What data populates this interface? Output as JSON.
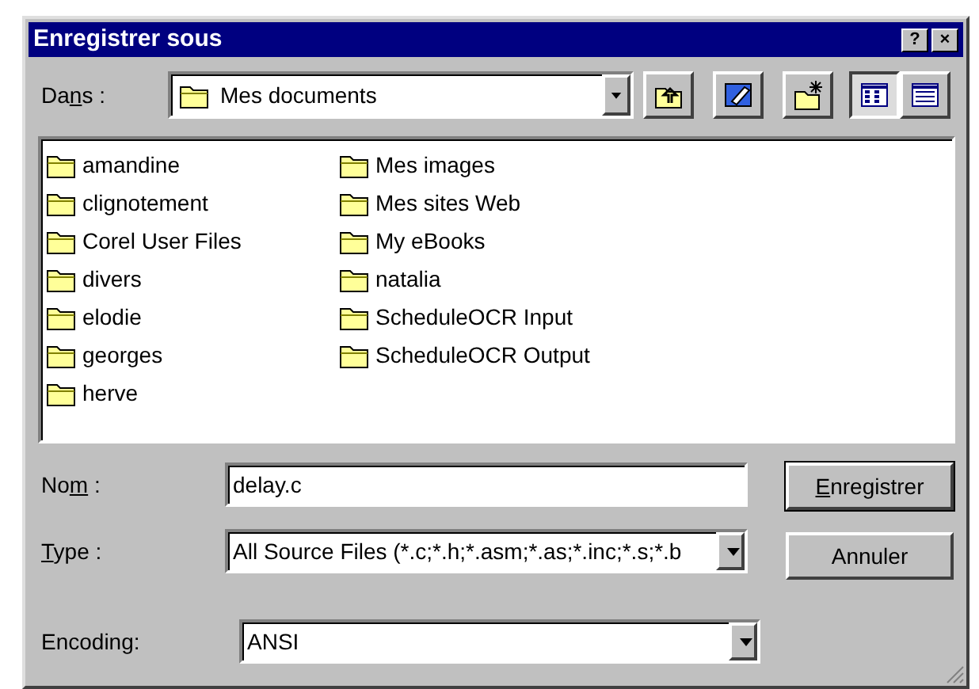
{
  "window": {
    "title": "Enregistrer sous",
    "title_buttons": [
      "?",
      "×"
    ]
  },
  "location": {
    "label": {
      "pre": "Da",
      "key": "n",
      "post": "s :"
    },
    "value": "Mes documents"
  },
  "toolbar": [
    {
      "kind": "up"
    },
    {
      "kind": "desktop"
    },
    {
      "kind": "new-folder"
    },
    {
      "kind": "list",
      "selected": true
    },
    {
      "kind": "details",
      "selected": false
    }
  ],
  "files": [
    "amandine",
    "clignotement",
    "Corel User Files",
    "divers",
    "elodie",
    "georges",
    "herve",
    "Mes images",
    "Mes sites Web",
    "My eBooks",
    "natalia",
    "ScheduleOCR Input",
    "ScheduleOCR Output"
  ],
  "fields": [
    {
      "kind": "text",
      "label": {
        "pre": "No",
        "key": "m",
        "post": " :"
      },
      "value": "delay.c"
    },
    {
      "kind": "combo",
      "label": {
        "key": "T",
        "post": "ype :"
      },
      "value": "All Source Files (*.c;*.h;*.asm;*.as;*.inc;*.s;*.b"
    },
    {
      "kind": "combo",
      "label": {
        "pre": "Encoding:"
      },
      "value": "ANSI"
    }
  ],
  "buttons": [
    {
      "label": {
        "key": "E",
        "post": "nregistrer"
      },
      "default": true
    },
    {
      "label": {
        "pre": "Annuler"
      },
      "default": false
    }
  ]
}
